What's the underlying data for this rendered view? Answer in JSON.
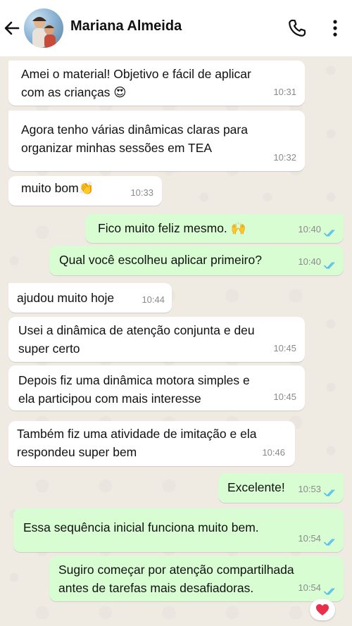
{
  "header": {
    "contact_name": "Mariana Almeida"
  },
  "messages": [
    {
      "lines": [
        "Amei o material! Objetivo e fácil de aplicar",
        "com as crianças 😍"
      ],
      "time": "10:31",
      "direction": "in"
    },
    {
      "lines": [
        "Agora tenho várias dinâmicas claras para",
        "organizar minhas sessões em TEA"
      ],
      "time": "10:32",
      "direction": "in"
    },
    {
      "lines": [
        "muito bom👏"
      ],
      "time": "10:33",
      "direction": "in"
    },
    {
      "lines": [
        "Fico muito feliz mesmo. 🙌"
      ],
      "time": "10:40",
      "direction": "out",
      "status": "read"
    },
    {
      "lines": [
        "Qual você escolheu aplicar primeiro?"
      ],
      "time": "10:40",
      "direction": "out",
      "status": "read"
    },
    {
      "lines": [
        "ajudou muito hoje"
      ],
      "time": "10:44",
      "direction": "in"
    },
    {
      "lines": [
        "Usei a dinâmica de atenção conjunta e deu",
        "super certo"
      ],
      "time": "10:45",
      "direction": "in"
    },
    {
      "lines": [
        "Depois fiz uma dinâmica motora simples e",
        "ela participou com mais interesse"
      ],
      "time": "10:45",
      "direction": "in"
    },
    {
      "lines": [
        "Também fiz uma atividade de imitação e ela",
        "respondeu super bem"
      ],
      "time": "10:46",
      "direction": "in"
    },
    {
      "lines": [
        "Excelente!"
      ],
      "time": "10:53",
      "direction": "out",
      "status": "read"
    },
    {
      "lines": [
        "Essa sequência inicial funciona muito bem."
      ],
      "time": "10:54",
      "direction": "out",
      "status": "read"
    },
    {
      "lines": [
        "Sugiro começar por atenção compartilhada",
        "antes de tarefas mais desafiadoras."
      ],
      "time": "10:54",
      "direction": "out",
      "status": "read"
    }
  ],
  "reaction": {
    "emoji": "❤️"
  },
  "colors": {
    "incoming_bubble": "#ffffff",
    "outgoing_bubble": "#d9fdd3",
    "read_ticks": "#53bdeb",
    "chat_background": "#efeae2"
  },
  "icons": [
    "back-arrow-icon",
    "phone-icon",
    "more-vertical-icon",
    "double-check-icon",
    "heart-icon"
  ]
}
